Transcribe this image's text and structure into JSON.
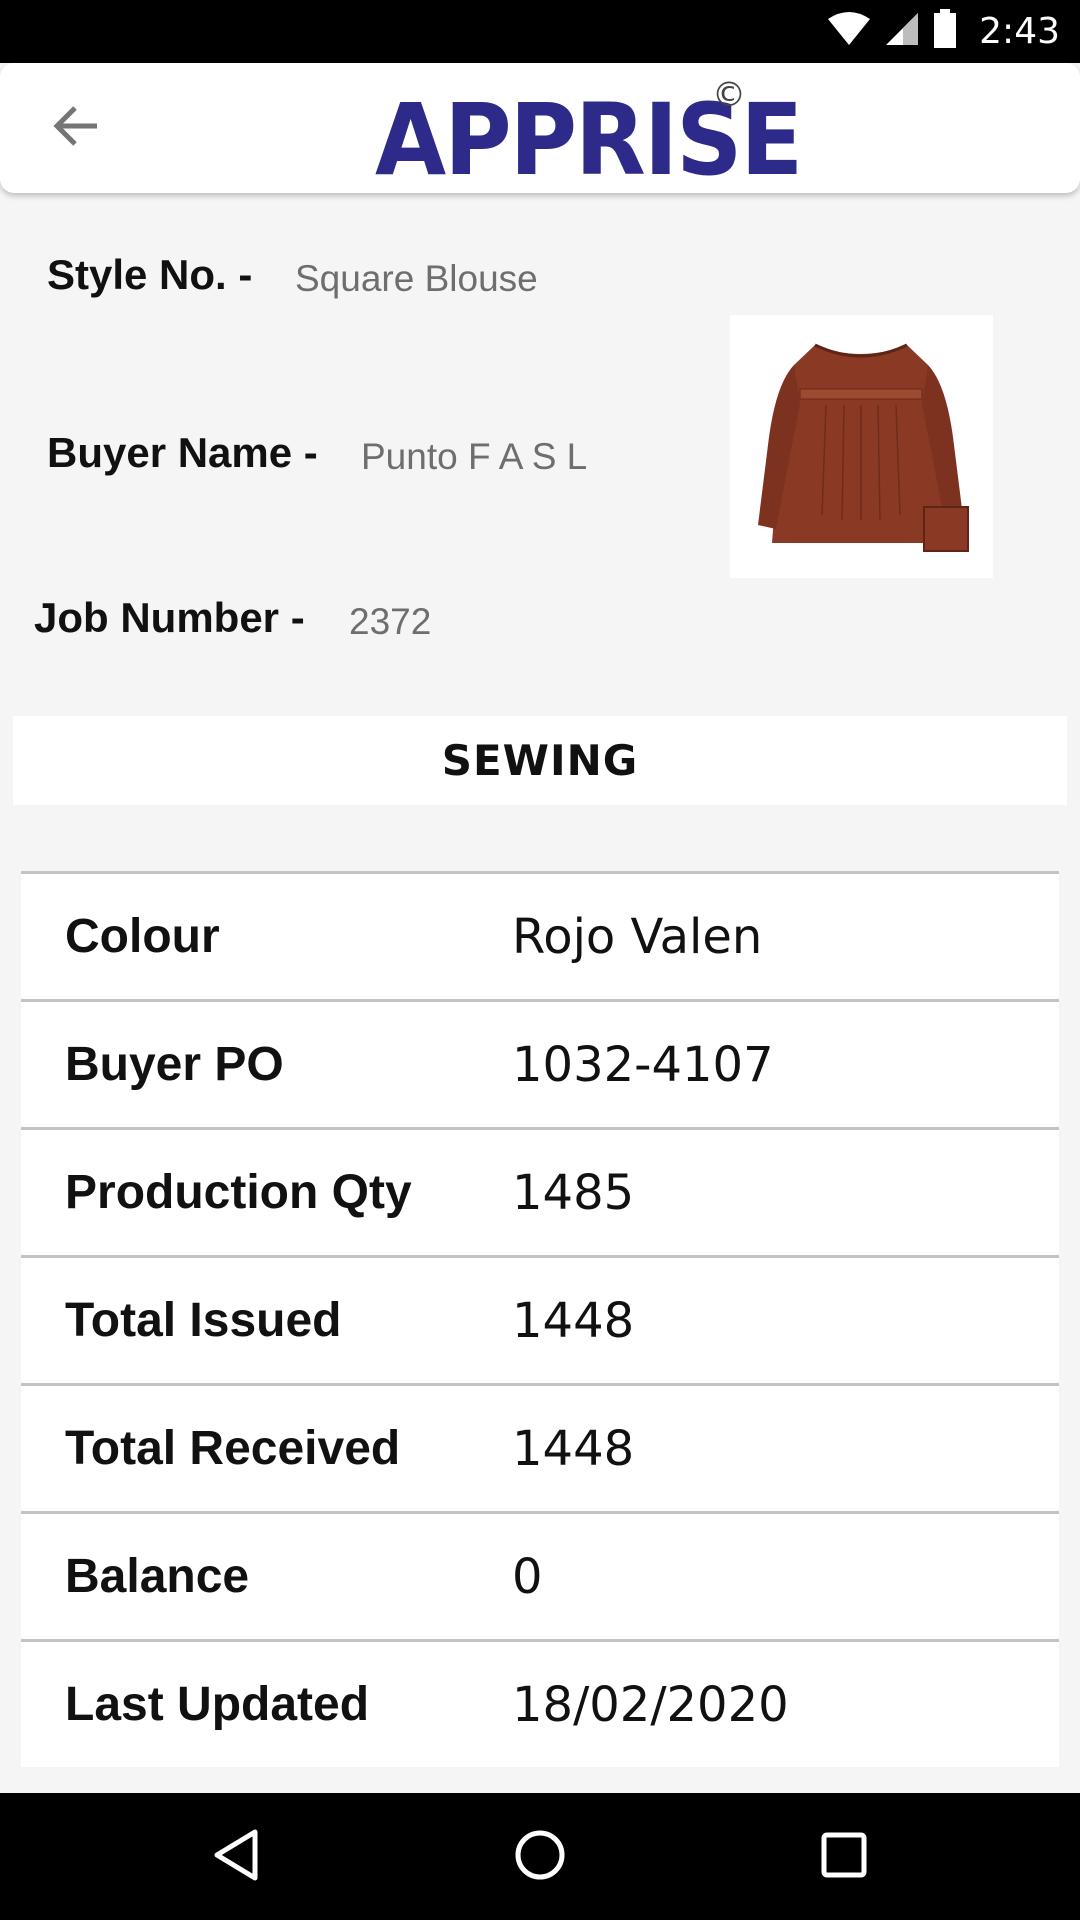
{
  "status_bar": {
    "time": "2:43",
    "icons": [
      "wifi-icon",
      "signal-icon",
      "battery-icon"
    ]
  },
  "app_bar": {
    "logo_text": "APPRISE",
    "logo_mark": "©",
    "back_icon": "arrow-left-icon"
  },
  "info": {
    "style_label": "Style No. -",
    "style_value": "Square Blouse",
    "buyer_label": "Buyer Name -",
    "buyer_value": "Punto F A S L",
    "job_label": "Job Number -",
    "job_value": "2372",
    "product_image": "blouse-photo"
  },
  "section": {
    "title": "SEWING"
  },
  "table": {
    "rows": [
      {
        "label": "Colour",
        "value": "Rojo Valen"
      },
      {
        "label": "Buyer PO",
        "value": "1032-4107"
      },
      {
        "label": "Production Qty",
        "value": "1485"
      },
      {
        "label": "Total Issued",
        "value": "1448"
      },
      {
        "label": "Total Received",
        "value": "1448"
      },
      {
        "label": "Balance",
        "value": "0"
      },
      {
        "label": "Last Updated",
        "value": "18/02/2020"
      }
    ]
  },
  "nav_bar": {
    "icons": [
      "back-triangle-icon",
      "home-circle-icon",
      "recents-square-icon"
    ]
  },
  "colors": {
    "brand": "#2e2a8a",
    "blouse": "#8a3a24"
  }
}
